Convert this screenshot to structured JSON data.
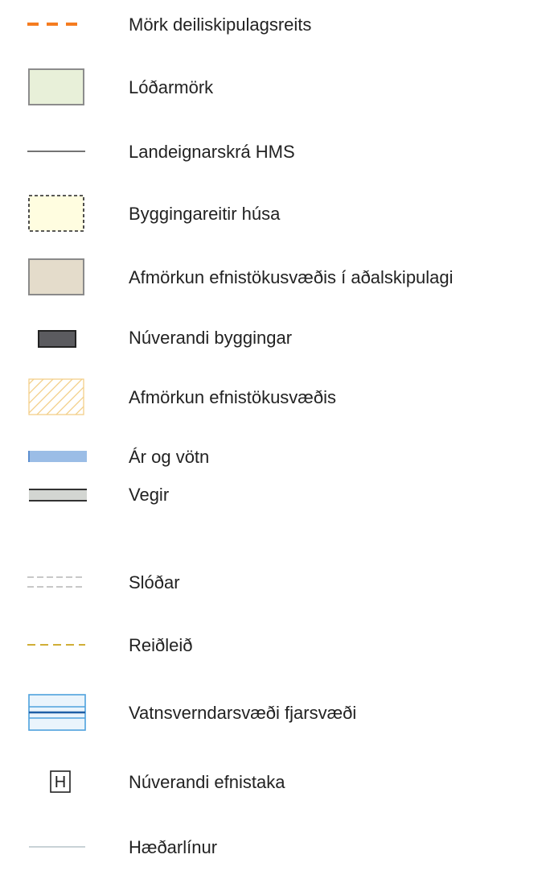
{
  "legend": {
    "items": [
      {
        "symbol": "orange-dashed-boundary-line",
        "label": "Mörk deiliskipulagsreits"
      },
      {
        "symbol": "light-green-filled-box",
        "label": "Lóðarmörk"
      },
      {
        "symbol": "thin-black-line",
        "label": "Landeignarskrá HMS"
      },
      {
        "symbol": "dashed-yellow-box",
        "label": "Byggingareitir húsa"
      },
      {
        "symbol": "beige-filled-box",
        "label": "Afmörkun efnistökusvæðis í aðalskipulagi"
      },
      {
        "symbol": "dark-grey-building-box",
        "label": "Núverandi byggingar"
      },
      {
        "symbol": "hatched-orange-box",
        "label": "Afmörkun efnistökusvæðis"
      },
      {
        "symbol": "blue-water-band",
        "label": "Ár og vötn"
      },
      {
        "symbol": "grey-road-band",
        "label": "Vegir"
      },
      {
        "symbol": "grey-dashed-double-line",
        "label": "Slóðar"
      },
      {
        "symbol": "ochre-dashed-line",
        "label": "Reiðleið"
      },
      {
        "symbol": "blue-striped-box",
        "label": "Vatnsverndarsvæði fjarsvæði"
      },
      {
        "symbol": "boxed-letter-symbol",
        "label": "Núverandi efnistaka",
        "symbol_text": "H"
      },
      {
        "symbol": "thin-grey-line",
        "label": "Hæðarlínur"
      }
    ]
  },
  "colors": {
    "boundary_orange": "#f57c20",
    "lot_fill": "#e8f0d9",
    "lot_stroke": "#8c8c8c",
    "building_area_fill": "#fffde0",
    "beige_fill": "#e4dccb",
    "building_fill": "#5b5b5f",
    "hatch_orange": "#f3cf8a",
    "water_blue": "#9bbde6",
    "road_fill": "#d3d6d2",
    "path_grey": "#b5b5b5",
    "riding_ochre": "#c9a21a",
    "protection_blue": "#4ea1dd",
    "contour_grey": "#b6c3c9"
  }
}
